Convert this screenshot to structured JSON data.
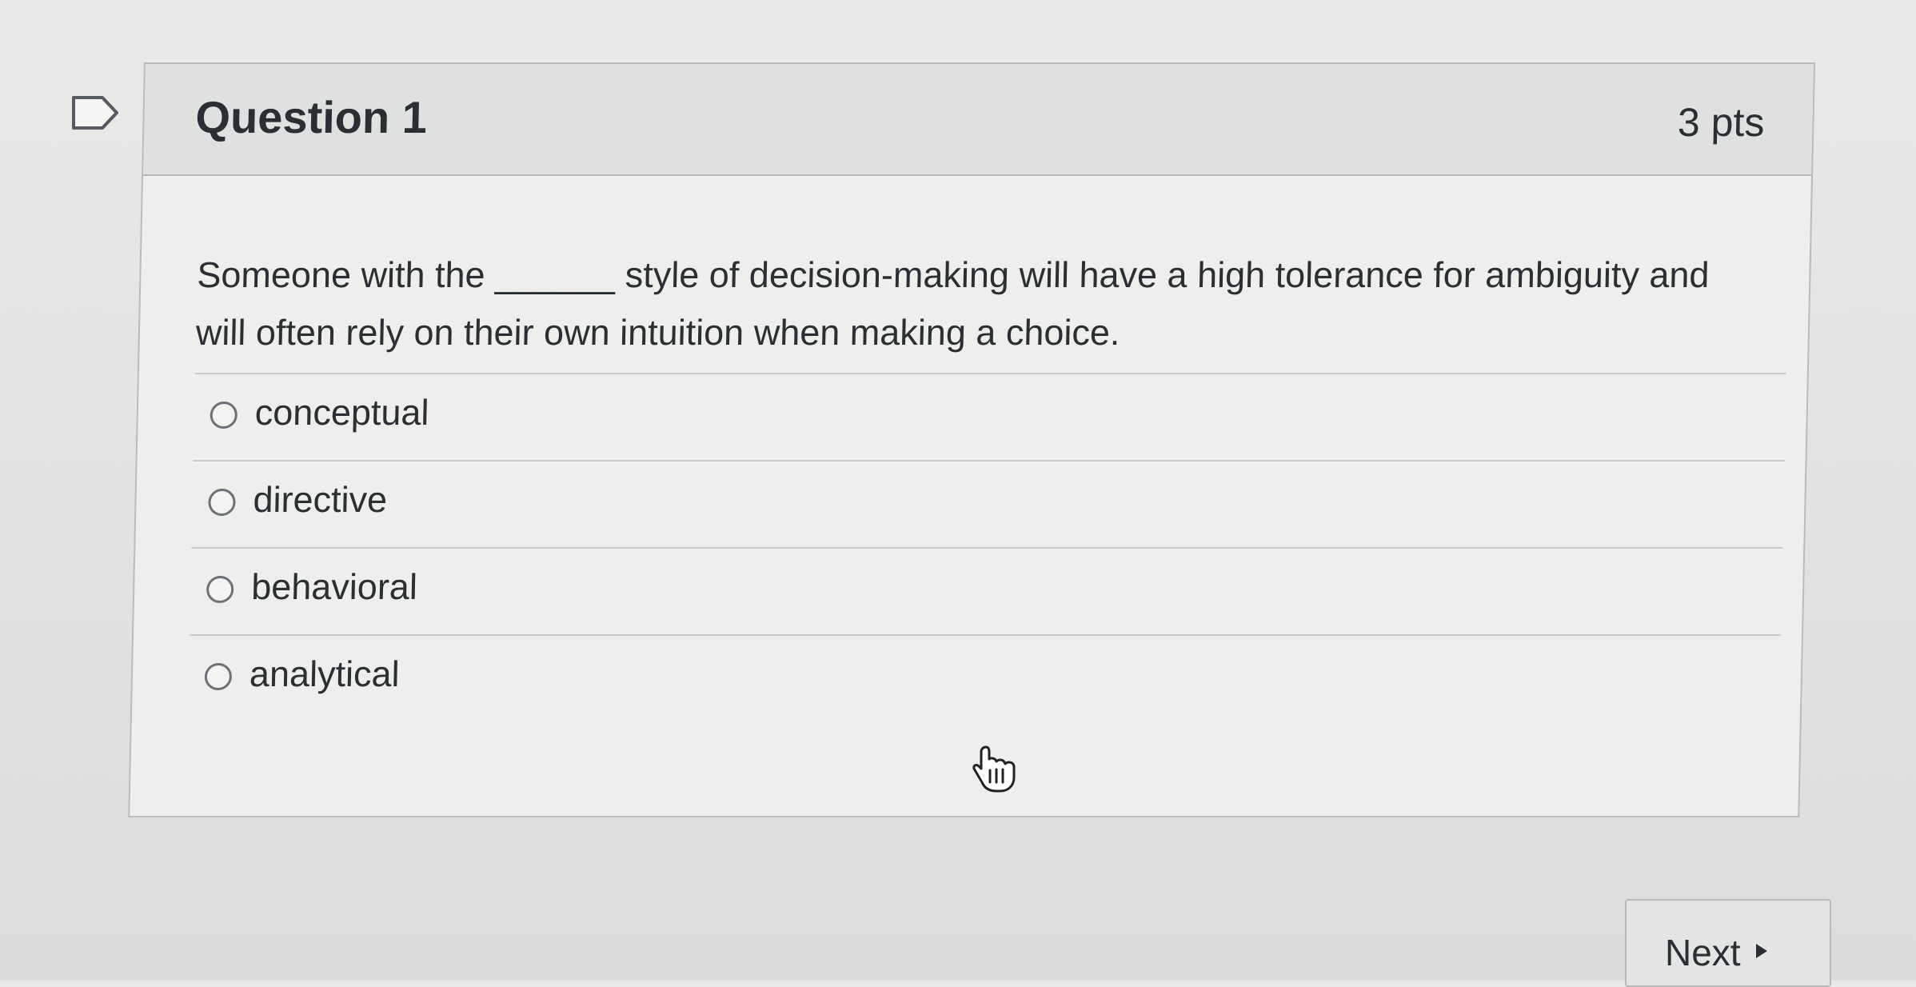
{
  "question": {
    "title": "Question 1",
    "points": "3 pts",
    "text": "Someone with the ______ style of decision-making will have a high tolerance for ambiguity and will often rely on their own intuition when making a choice.",
    "answers": [
      {
        "label": "conceptual"
      },
      {
        "label": "directive"
      },
      {
        "label": "behavioral"
      },
      {
        "label": "analytical"
      }
    ]
  },
  "navigation": {
    "next_label": "Next"
  },
  "icons": {
    "flag": "flag-icon",
    "radio": "radio-icon",
    "cursor": "hand-pointer-icon",
    "next_arrow": "triangle-right-icon"
  },
  "colors": {
    "background": "#e5e5e3",
    "card_background": "#eeeeec",
    "header_background": "#dfe0e0",
    "border": "#b9bbbc",
    "text": "#2a2f33"
  }
}
